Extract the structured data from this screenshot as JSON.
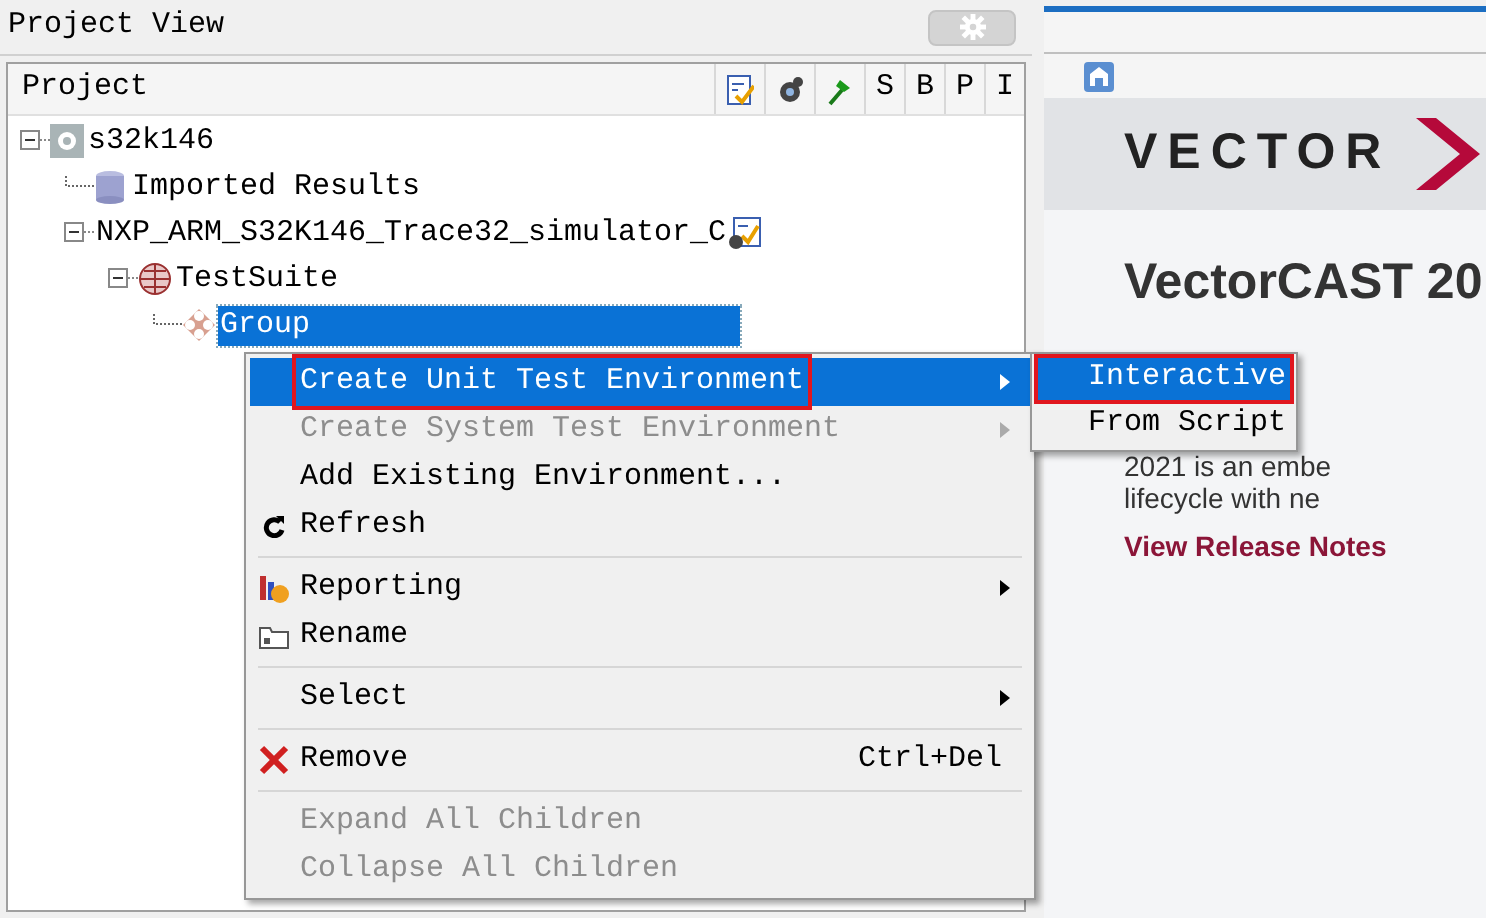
{
  "panel": {
    "title": "Project View"
  },
  "columns": [
    {
      "kind": "icon"
    },
    {
      "kind": "icon"
    },
    {
      "kind": "icon"
    },
    {
      "kind": "text",
      "label": "S"
    },
    {
      "kind": "text",
      "label": "B"
    },
    {
      "kind": "text",
      "label": "P"
    },
    {
      "kind": "text",
      "label": "I"
    }
  ],
  "tree": {
    "header": "Project",
    "nodes": [
      {
        "label": "s32k146",
        "expanded": true,
        "selected": false,
        "children": [
          {
            "label": "Imported Results",
            "selected": false
          },
          {
            "label": "NXP_ARM_S32K146_Trace32_simulator_C",
            "expanded": true,
            "selected": false,
            "children": [
              {
                "label": "TestSuite",
                "expanded": true,
                "selected": false,
                "children": [
                  {
                    "label": "Group",
                    "selected": true
                  }
                ]
              }
            ]
          }
        ]
      }
    ]
  },
  "context_menu": [
    {
      "kind": "item",
      "label": "Create Unit Test Environment",
      "disabled": false,
      "selected": true,
      "outlined": true,
      "submenu": true
    },
    {
      "kind": "item",
      "label": "Create System Test Environment",
      "disabled": true,
      "selected": false,
      "outlined": false,
      "submenu": true
    },
    {
      "kind": "item",
      "label": "Add Existing Environment...",
      "disabled": false,
      "selected": false,
      "outlined": false,
      "submenu": false
    },
    {
      "kind": "item",
      "label": "Refresh",
      "disabled": false,
      "selected": false,
      "outlined": false,
      "submenu": false
    },
    {
      "kind": "separator"
    },
    {
      "kind": "item",
      "label": "Reporting",
      "disabled": false,
      "selected": false,
      "outlined": false,
      "submenu": true
    },
    {
      "kind": "item",
      "label": "Rename",
      "disabled": false,
      "selected": false,
      "outlined": false,
      "submenu": false
    },
    {
      "kind": "separator"
    },
    {
      "kind": "item",
      "label": "Select",
      "disabled": false,
      "selected": false,
      "outlined": false,
      "submenu": true
    },
    {
      "kind": "separator"
    },
    {
      "kind": "item",
      "label": "Remove",
      "shortcut": "Ctrl+Del",
      "disabled": false,
      "selected": false,
      "outlined": false,
      "submenu": false
    },
    {
      "kind": "separator"
    },
    {
      "kind": "item",
      "label": "Expand All Children",
      "disabled": true,
      "selected": false,
      "outlined": false,
      "submenu": false
    },
    {
      "kind": "item",
      "label": "Collapse All Children",
      "disabled": true,
      "selected": false,
      "outlined": false,
      "submenu": false
    }
  ],
  "submenu": [
    {
      "label": "Interactive",
      "selected": true,
      "outlined": true
    },
    {
      "label": "From Script",
      "selected": false,
      "outlined": false
    }
  ],
  "welcome": {
    "logo": "VECTOR",
    "title": "VectorCAST 20",
    "lines": [
      "2021 is an embe",
      "lifecycle with ne"
    ],
    "link": "View Release Notes"
  }
}
